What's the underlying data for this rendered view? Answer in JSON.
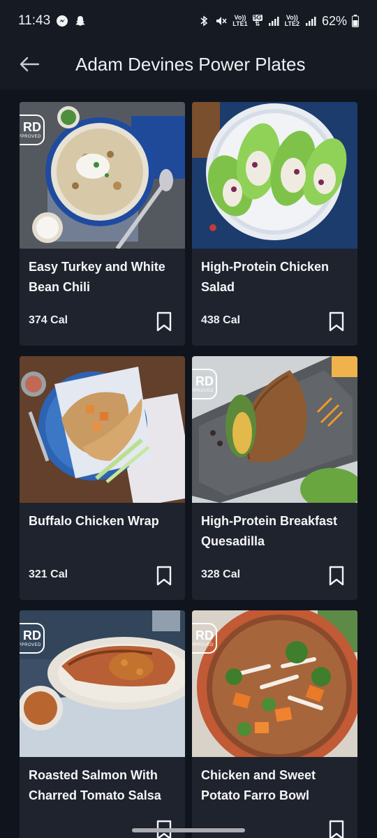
{
  "status_bar": {
    "time": "11:43",
    "lte1": "LTE1",
    "lte2": "LTE2",
    "net_5g": "5G",
    "vol": "Vo))",
    "battery": "62%"
  },
  "app_bar": {
    "title": "Adam Devines Power Plates"
  },
  "badge": {
    "rd": "RD",
    "approved": "APPROVED"
  },
  "recipes": [
    {
      "title": "Easy Turkey and White Bean Chili",
      "calories": "374 Cal",
      "rd_badge": true,
      "saved": false
    },
    {
      "title": "High-Protein Chicken Salad",
      "calories": "438 Cal",
      "rd_badge": false,
      "saved": false
    },
    {
      "title": "Buffalo Chicken Wrap",
      "calories": "321 Cal",
      "rd_badge": false,
      "saved": false
    },
    {
      "title": "High-Protein Breakfast Quesadilla",
      "calories": "328 Cal",
      "rd_badge": true,
      "saved": false
    },
    {
      "title": "Roasted Salmon With Charred Tomato Salsa",
      "calories": "",
      "rd_badge": true,
      "saved": false
    },
    {
      "title": "Chicken and Sweet Potato Farro Bowl",
      "calories": "",
      "rd_badge": true,
      "saved": false
    }
  ],
  "colors": {
    "background": "#10141c",
    "app_bar": "#151a23",
    "card": "#1f232d",
    "text": "#f4f5f7"
  }
}
